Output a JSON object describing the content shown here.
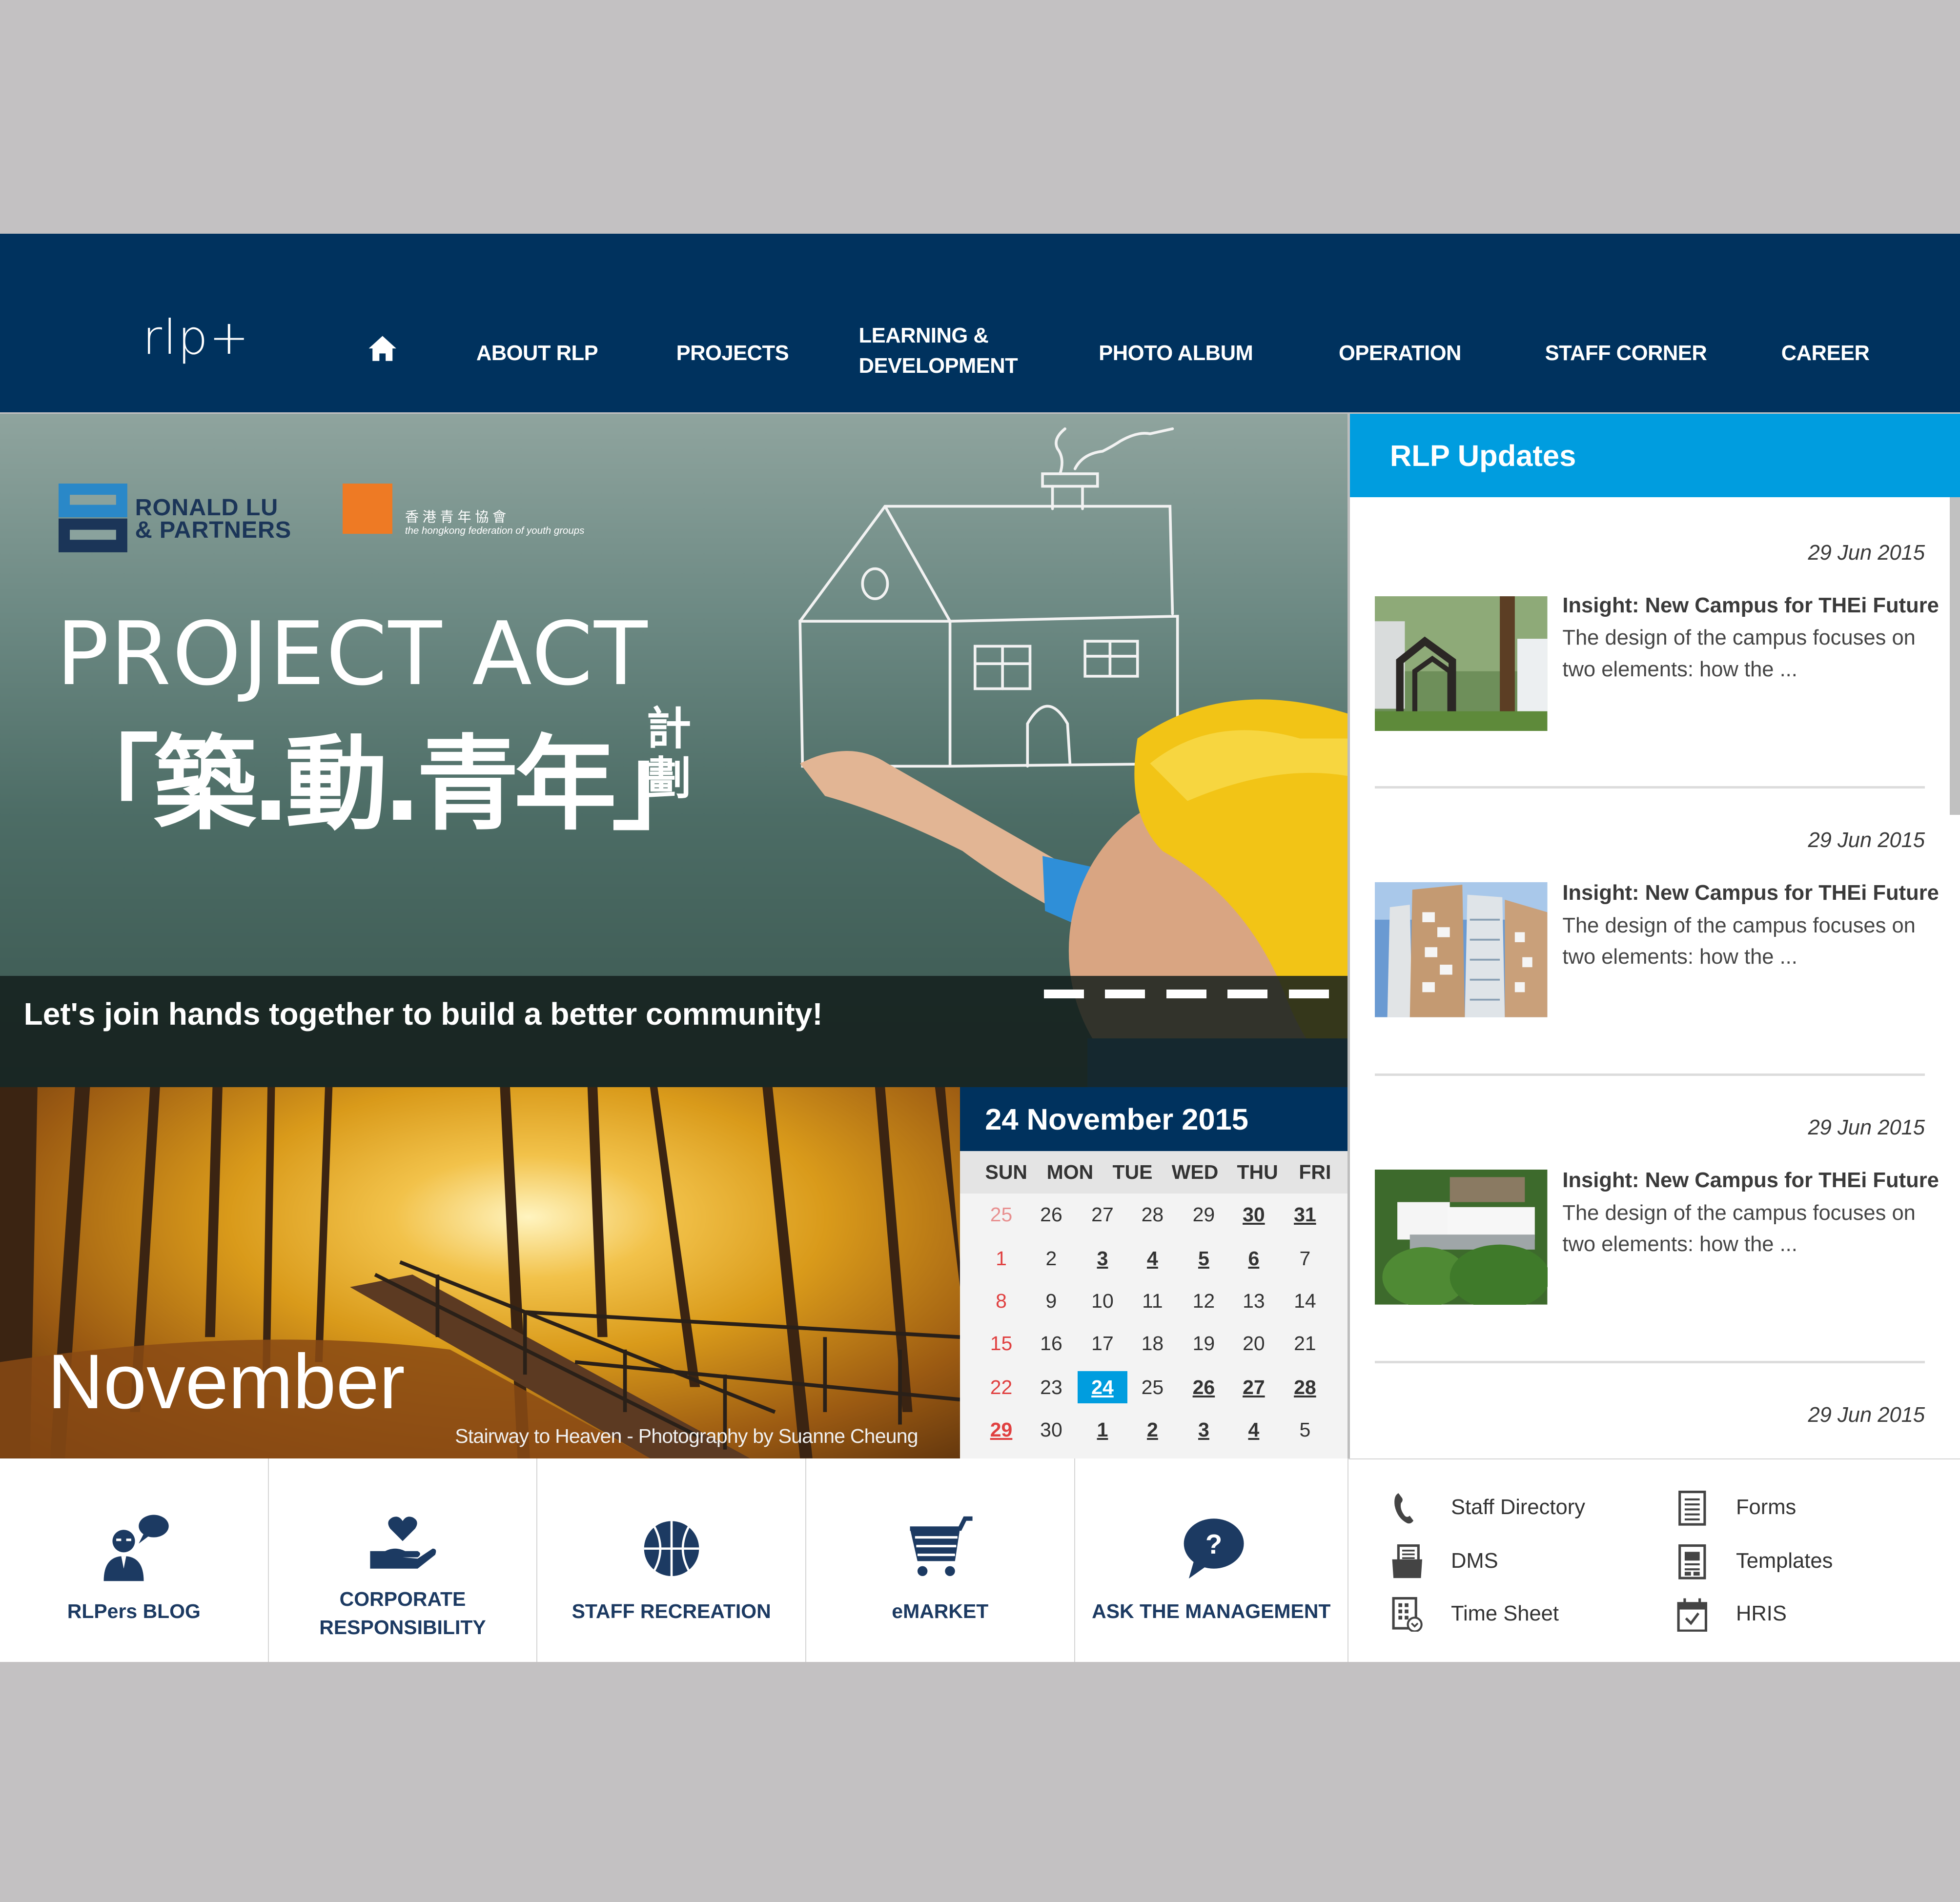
{
  "nav": {
    "logo": "rlp+",
    "home_icon": "home-icon",
    "items": [
      {
        "label": "ABOUT RLP"
      },
      {
        "label": "PROJECTS"
      },
      {
        "label": "LEARNING &",
        "label2": "DEVELOPMENT"
      },
      {
        "label": "PHOTO ALBUM"
      },
      {
        "label": "OPERATION"
      },
      {
        "label": "STAFF CORNER"
      },
      {
        "label": "CAREER"
      }
    ]
  },
  "hero": {
    "logo_rlp_line1": "RONALD LU",
    "logo_rlp_line2": "& PARTNERS",
    "logo_fed_cn": "香港青年協會",
    "logo_fed_en": "the hongkong federation of youth groups",
    "title_en": "PROJECT ACT",
    "title_cn": "「築.動.青年」",
    "title_cn_suffix": "計劃",
    "caption": "Let's join hands together to build a better community!",
    "slide_count": 5,
    "active_slide": 1
  },
  "updates": {
    "title": "RLP Updates",
    "items": [
      {
        "date": "29 Jun 2015",
        "title": "Insight: New Campus for THEi Future",
        "desc_line1": "The design of the campus focuses on",
        "desc_line2": "two elements: how the ..."
      },
      {
        "date": "29 Jun 2015",
        "title": "Insight: New Campus for THEi Future",
        "desc_line1": "The design of the campus focuses on",
        "desc_line2": "two elements: how the ..."
      },
      {
        "date": "29 Jun 2015",
        "title": "Insight: New Campus for THEi Future",
        "desc_line1": "The design of the campus focuses on",
        "desc_line2": "two elements: how the ..."
      },
      {
        "date": "29 Jun 2015"
      }
    ]
  },
  "photo": {
    "month": "November",
    "credit": "Stairway to Heaven - Photography by Suanne Cheung"
  },
  "calendar": {
    "title": "24 November 2015",
    "weekdays": [
      "SUN",
      "MON",
      "TUE",
      "WED",
      "THU",
      "FRI"
    ],
    "weeks": [
      [
        {
          "d": "25",
          "t": "sun prev"
        },
        {
          "d": "26"
        },
        {
          "d": "27"
        },
        {
          "d": "28"
        },
        {
          "d": "29"
        },
        {
          "d": "30",
          "t": "u"
        },
        {
          "d": "31",
          "t": "u"
        }
      ],
      [
        {
          "d": "1",
          "t": "sun"
        },
        {
          "d": "2"
        },
        {
          "d": "3",
          "t": "u"
        },
        {
          "d": "4",
          "t": "u"
        },
        {
          "d": "5",
          "t": "u"
        },
        {
          "d": "6",
          "t": "u"
        },
        {
          "d": "7"
        }
      ],
      [
        {
          "d": "8",
          "t": "sun"
        },
        {
          "d": "9"
        },
        {
          "d": "10"
        },
        {
          "d": "11"
        },
        {
          "d": "12"
        },
        {
          "d": "13"
        },
        {
          "d": "14"
        }
      ],
      [
        {
          "d": "15",
          "t": "sun"
        },
        {
          "d": "16"
        },
        {
          "d": "17"
        },
        {
          "d": "18"
        },
        {
          "d": "19"
        },
        {
          "d": "20"
        },
        {
          "d": "21"
        }
      ],
      [
        {
          "d": "22",
          "t": "sun"
        },
        {
          "d": "23"
        },
        {
          "d": "24",
          "t": "u today"
        },
        {
          "d": "25"
        },
        {
          "d": "26",
          "t": "u"
        },
        {
          "d": "27",
          "t": "u"
        },
        {
          "d": "28",
          "t": "u"
        }
      ],
      [
        {
          "d": "29",
          "t": "sun u"
        },
        {
          "d": "30"
        },
        {
          "d": "1",
          "t": "u"
        },
        {
          "d": "2",
          "t": "u"
        },
        {
          "d": "3",
          "t": "u"
        },
        {
          "d": "4",
          "t": "u"
        },
        {
          "d": "5"
        }
      ]
    ],
    "today": "24"
  },
  "tiles": [
    {
      "label": "RLPers BLOG",
      "icon": "blogger-icon"
    },
    {
      "label": "CORPORATE",
      "label2": "RESPONSIBILITY",
      "icon": "heart-hand-icon"
    },
    {
      "label": "STAFF RECREATION",
      "icon": "basketball-icon"
    },
    {
      "label": "eMARKET",
      "icon": "cart-icon"
    },
    {
      "label": "ASK THE MANAGEMENT",
      "icon": "question-bubble-icon"
    }
  ],
  "quick_links": [
    {
      "label": "Staff Directory",
      "icon": "phone-icon"
    },
    {
      "label": "Forms",
      "icon": "form-icon"
    },
    {
      "label": "DMS",
      "icon": "folder-icon"
    },
    {
      "label": "Templates",
      "icon": "template-icon"
    },
    {
      "label": "Time Sheet",
      "icon": "timesheet-icon"
    },
    {
      "label": "HRIS",
      "icon": "calendar-check-icon"
    }
  ],
  "colors": {
    "nav_bg": "#00325e",
    "accent": "#009ddf",
    "tile_text": "#1c3a62",
    "sunday": "#e04040"
  }
}
